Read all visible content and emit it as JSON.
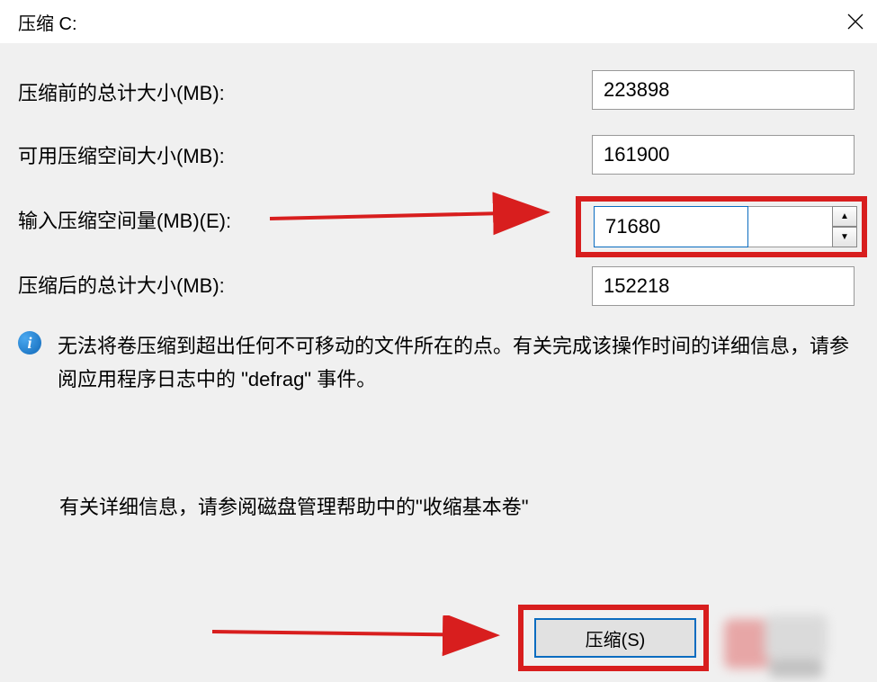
{
  "title": "压缩 C:",
  "labels": {
    "total_before": "压缩前的总计大小(MB):",
    "available": "可用压缩空间大小(MB):",
    "enter_amount": "输入压缩空间量(MB)(E):",
    "total_after": "压缩后的总计大小(MB):"
  },
  "values": {
    "total_before": "223898",
    "available": "161900",
    "enter_amount": "71680",
    "total_after": "152218"
  },
  "info_icon_glyph": "i",
  "info_text": "无法将卷压缩到超出任何不可移动的文件所在的点。有关完成该操作时间的详细信息，请参阅应用程序日志中的 \"defrag\" 事件。",
  "help_text": "有关详细信息，请参阅磁盘管理帮助中的\"收缩基本卷\"",
  "buttons": {
    "shrink": "压缩(S)"
  },
  "spinner": {
    "up": "▲",
    "down": "▼"
  },
  "annotation_color": "#d81e1e"
}
